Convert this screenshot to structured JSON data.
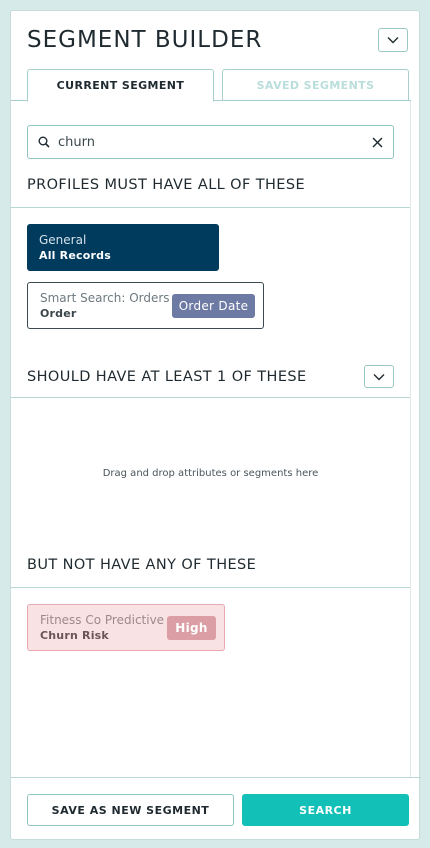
{
  "header": {
    "title": "SEGMENT BUILDER"
  },
  "tabs": [
    {
      "label": "CURRENT SEGMENT",
      "active": true
    },
    {
      "label": "SAVED SEGMENTS",
      "active": false
    }
  ],
  "search": {
    "value": "churn",
    "placeholder": ""
  },
  "sections": {
    "must": {
      "title": "PROFILES MUST HAVE ALL OF THESE",
      "cards": [
        {
          "line1": "General",
          "line2": "All Records"
        },
        {
          "line1": "Smart Search: Orders",
          "line2": "Order",
          "pill": "Order Date"
        }
      ]
    },
    "should": {
      "title": "SHOULD HAVE AT LEAST 1 OF THESE",
      "placeholder": "Drag and drop attributes or segments here"
    },
    "not": {
      "title": "BUT NOT HAVE ANY OF THESE",
      "cards": [
        {
          "line1": "Fitness Co Predictive",
          "line2": "Churn Risk",
          "pill": "High"
        }
      ]
    }
  },
  "footer": {
    "save_label": "SAVE AS NEW SEGMENT",
    "search_label": "SEARCH"
  },
  "colors": {
    "accent": "#12c0b8",
    "background": "#d6ebe9",
    "general_card": "#003a5d",
    "order_date_pill": "#6d7aa3",
    "exclude_card": "#f9e2e4",
    "high_pill": "#dc9ea5"
  },
  "icons": [
    "chevron-down-icon",
    "search-icon",
    "close-icon"
  ]
}
